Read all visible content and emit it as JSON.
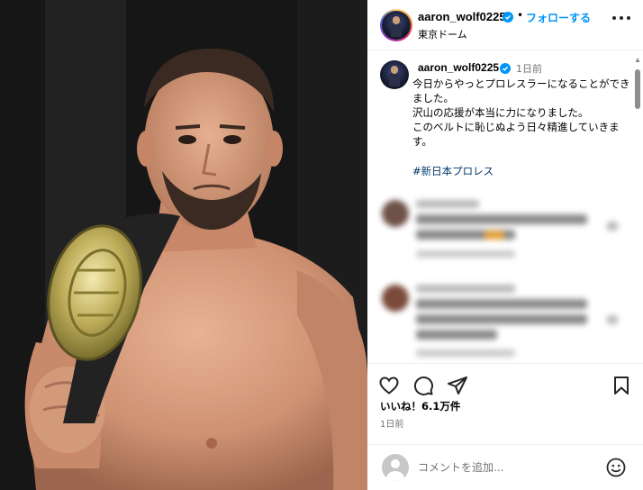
{
  "post": {
    "username": "aaron_wolf0225",
    "location": "東京ドーム",
    "follow_label": "フォローする",
    "dot": "•"
  },
  "caption": {
    "username": "aaron_wolf0225",
    "time": "1日前",
    "text": "今日からやっとプロレスラーになることができました。\n沢山の応援が本当に力になりました。\nこのベルトに恥じぬよう日々精進していきます。",
    "hashtag": "#新日本プロレス"
  },
  "engagement": {
    "likes": "いいね！6.1万件",
    "posted": "1日前"
  },
  "composer": {
    "placeholder": "コメントを追加..."
  },
  "icons": {
    "like": "heart-icon",
    "comment": "comment-bubble-icon",
    "share": "paper-plane-icon",
    "save": "bookmark-icon",
    "verified": "verified-badge-icon",
    "more": "more-options-icon",
    "emoji": "emoji-icon"
  },
  "colors": {
    "accent": "#0095f6",
    "verified": "#0095f6",
    "hashtag": "#00376b",
    "muted": "#737373"
  }
}
